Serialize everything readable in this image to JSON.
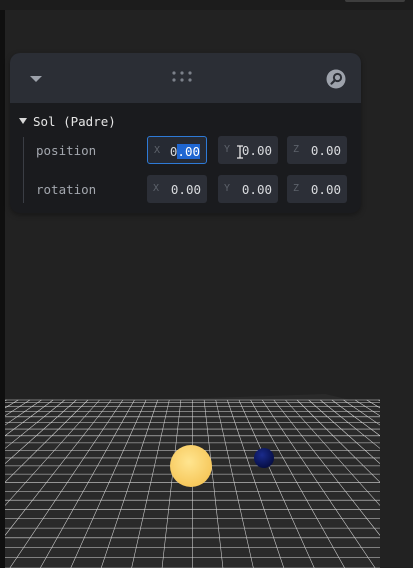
{
  "folder": {
    "title": "Sol (Padre)"
  },
  "rows": [
    {
      "label": "position",
      "fields": [
        {
          "axis": "X",
          "value": "0.00",
          "focused": true
        },
        {
          "axis": "Y",
          "value": "0.00"
        },
        {
          "axis": "Z",
          "value": "0.00"
        }
      ]
    },
    {
      "label": "rotation",
      "fields": [
        {
          "axis": "X",
          "value": "0.00"
        },
        {
          "axis": "Y",
          "value": "0.00"
        },
        {
          "axis": "Z",
          "value": "0.00"
        }
      ]
    }
  ],
  "focused_field": {
    "unselected_part": "0",
    "selected_part": ".00"
  },
  "colors": {
    "accent": "#2e7ad6",
    "sun": "#ffd36b",
    "planet": "#0c1a6e",
    "grid": "#d6d6d6"
  }
}
